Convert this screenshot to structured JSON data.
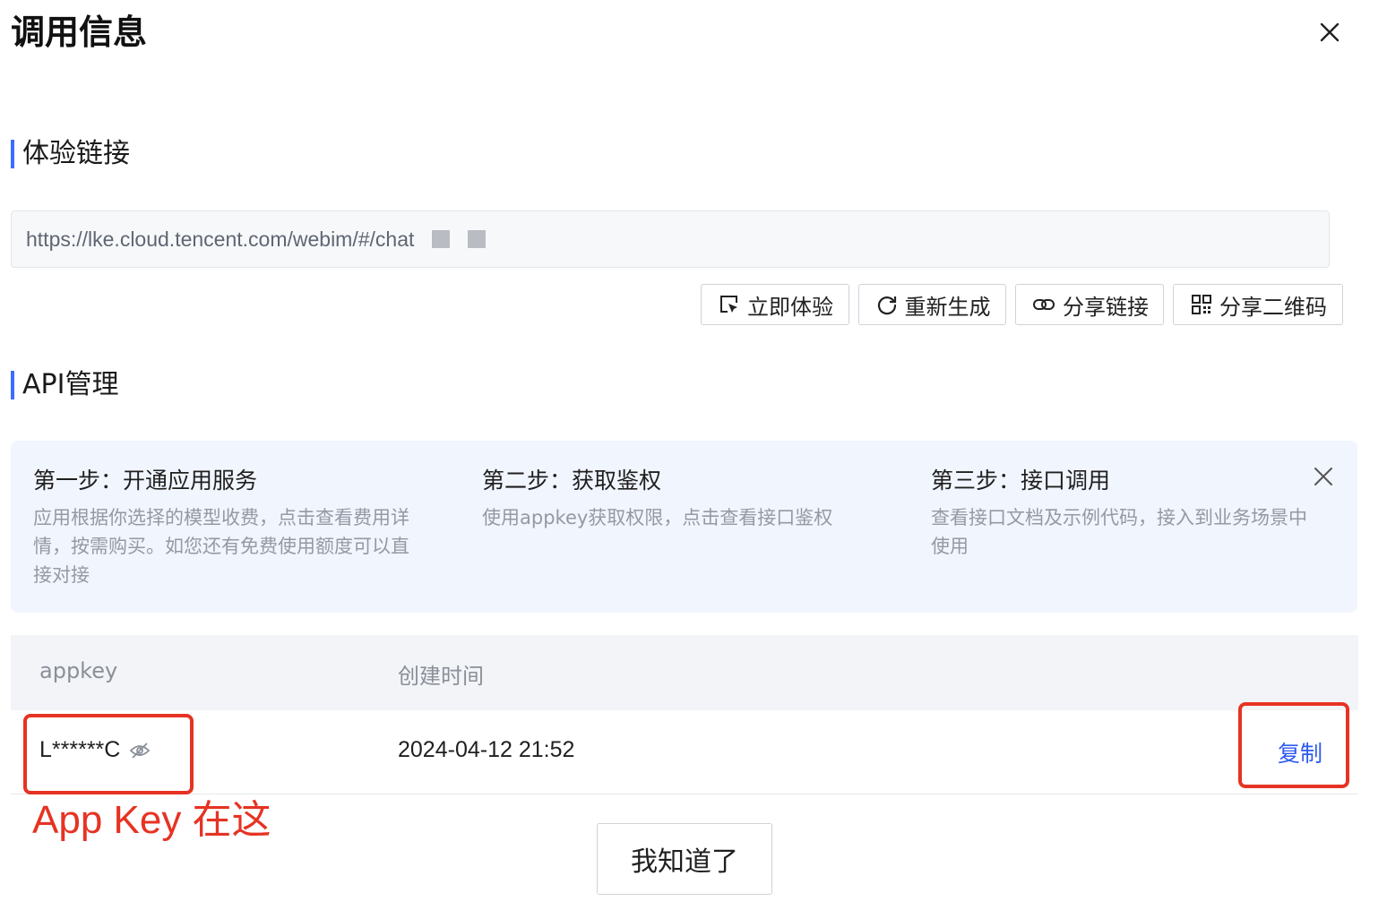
{
  "dialog": {
    "title": "调用信息"
  },
  "experience": {
    "section_title": "体验链接",
    "link_url": "https://lke.cloud.tencent.com/webim/#/chat",
    "buttons": [
      {
        "label": "立即体验",
        "icon": "cursor-click-icon"
      },
      {
        "label": "重新生成",
        "icon": "refresh-icon"
      },
      {
        "label": "分享链接",
        "icon": "link-icon"
      },
      {
        "label": "分享二维码",
        "icon": "qrcode-icon"
      }
    ]
  },
  "api": {
    "section_title": "API管理",
    "steps": [
      {
        "title": "第一步：开通应用服务",
        "desc": "应用根据你选择的模型收费，点击查看费用详情，按需购买。如您还有免费使用额度可以直接对接"
      },
      {
        "title": "第二步：获取鉴权",
        "desc": "使用appkey获取权限，点击查看接口鉴权"
      },
      {
        "title": "第三步：接口调用",
        "desc": "查看接口文档及示例代码，接入到业务场景中使用"
      }
    ],
    "table": {
      "columns": [
        "appkey",
        "创建时间"
      ],
      "rows": [
        {
          "appkey": "L******C",
          "created": "2024-04-12 21:52",
          "action": "复制"
        }
      ]
    }
  },
  "annotation": {
    "text": "App Key 在这",
    "color": "#e63323"
  },
  "footer": {
    "confirm_label": "我知道了"
  },
  "colors": {
    "accent": "#3d6dff",
    "link": "#2e5bef",
    "step_bg": "#f1f5fe"
  }
}
